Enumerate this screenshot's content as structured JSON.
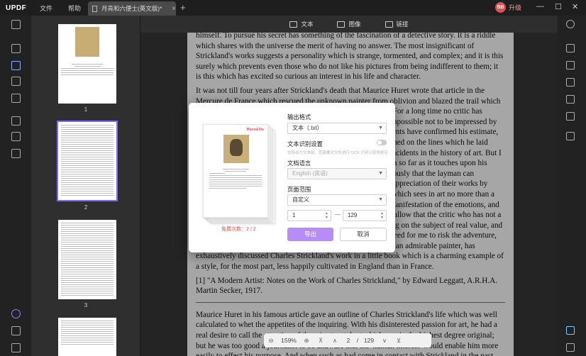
{
  "app": {
    "logo": "UPDF",
    "upgrade_label": "升级",
    "avatar_initials": "BB"
  },
  "menu": {
    "file": "文件",
    "help": "帮助"
  },
  "tab": {
    "label": "月亮和六便士(英文版)*",
    "close": "×",
    "add": "+"
  },
  "window_controls": {
    "minimize": "—",
    "maximize": "☐",
    "close": "✕"
  },
  "toolbar": {
    "text": "文本",
    "image": "图像",
    "link": "链接"
  },
  "thumbnails": [
    {
      "number": "1"
    },
    {
      "number": "2"
    },
    {
      "number": "3"
    }
  ],
  "document": {
    "paragraphs": [
      "himself. To pursue his secret has something of the fascination of a detective story. It is a riddle which shares with the universe the merit of having no answer. The most insignificant of Strickland's works suggests a personality which is strange, tormented, and complex; and it is this surely which prevents even those who do not like his pictures from being indifferent to them; it is this which has excited so curious an interest in his life and character.",
      "It was not till four years after Strickland's death that Maurice Huret wrote that article in the Mercure de France which rescued the unknown painter from oblivion and blazed the trail which succeeding writers, with more or less docility, have followed. For a long time no critic has enjoyed in France a more incontestable authority, and it was impossible not to be impressed by the claims he made; they seemed extravagant; but later judgments have confirmed his estimate, and the reputation of Charles Strickland is now firmly established on the lines which he laid down. The rise of this reputation is one of the most romantic incidents in the history of art. But I do not propose to deal with Charles Strickland's work except in so far as it touches upon his character. I cannot agree with the painters who claim superciliously that the layman can understand nothing of painting, and that he can best show his appreciation of their works by silence and a cheque-book. It is a grotesque misapprehension which sees in art no more than a craft comprehensible perfectly only to the craftsman: art is a manifestation of the emotions, and emotion speaks a language that all may understand. But I will allow that the critic who has not a practical knowledge of technique is seldom able to say anything on the subject of real value, and my ignorance of painting is extreme. Fortunately, there is no need for me to risk the adventure, since my friend, Mr. Edward Leggatt, an able writer as well as an admirable painter, has exhaustively discussed Charles Strickland's work in a little book which is a charming example of a style, for the most part, less happily cultivated in England than in France.",
      "[1] \"A Modern Artist: Notes on the Work of Charles Strickland,\" by Edward Leggatt, A.R.H.A. Martin Secker, 1917.",
      "Maurice Huret in his famous article gave an outline of Charles Strickland's life which was well calculated to whet the appetites of the inquiring. With his disinterested passion for art, he had a real desire to call the attention of the wise to a talent which was in the highest degree original; but he was too good a journalist to be unaware that the 'human interest' would enable him more easily to effect his purpose. And when such as had come in contact with Strickland in the past, writers"
    ]
  },
  "zoom": {
    "zoom_out": "⊖",
    "level": "159%",
    "zoom_in": "⊕",
    "first": "⊼",
    "prev": "∧",
    "current_page": "2",
    "separator": "/",
    "total_pages": "129",
    "next": "∨",
    "last": "⊻"
  },
  "dialog": {
    "output_format_label": "输出格式",
    "output_format_value": "文本（.txt）",
    "ocr_label": "文本识别设置",
    "ocr_hint": "在导出为文本前，您需要对文件进行 OCR 识别以获得更佳的结果，请先开启 OCR 功能。",
    "doc_language_label": "文档语言",
    "doc_language_value": "English (英语)",
    "page_range_label": "页面范围",
    "page_range_value": "自定义",
    "range_from": "1",
    "range_to": "129",
    "range_dash": "—",
    "export_button": "导出",
    "cancel_button": "取消",
    "free_count": "免费次数：2 / 2",
    "preview_brand": "Moon&Six"
  },
  "colors": {
    "accent": "#b68cf7",
    "warning": "#e04a4a"
  }
}
